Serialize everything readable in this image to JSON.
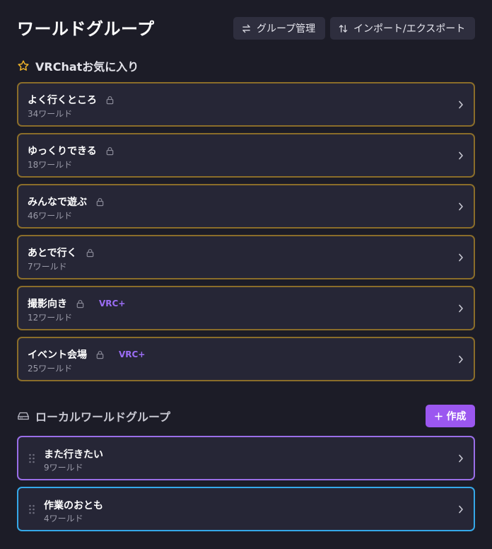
{
  "header": {
    "title": "ワールドグループ",
    "manage_label": "グループ管理",
    "import_export_label": "インポート/エクスポート"
  },
  "favorites": {
    "title": "VRChatお気に入り",
    "items": [
      {
        "name": "よく行くところ",
        "count": "34ワールド",
        "vrc_plus": ""
      },
      {
        "name": "ゆっくりできる",
        "count": "18ワールド",
        "vrc_plus": ""
      },
      {
        "name": "みんなで遊ぶ",
        "count": "46ワールド",
        "vrc_plus": ""
      },
      {
        "name": "あとで行く",
        "count": "7ワールド",
        "vrc_plus": ""
      },
      {
        "name": "撮影向き",
        "count": "12ワールド",
        "vrc_plus": "VRC+"
      },
      {
        "name": "イベント会場",
        "count": "25ワールド",
        "vrc_plus": "VRC+"
      }
    ]
  },
  "local": {
    "title": "ローカルワールドグループ",
    "create_label": "作成",
    "items": [
      {
        "name": "また行きたい",
        "count": "9ワールド"
      },
      {
        "name": "作業のおとも",
        "count": "4ワールド"
      }
    ]
  },
  "colors": {
    "background": "#1c1c27",
    "card": "#262636",
    "favorite_border": "#8a6d2a",
    "local_border_1": "#9a6ee8",
    "local_border_2": "#35a8e8",
    "accent": "#9b57f0",
    "star": "#f0b429"
  }
}
